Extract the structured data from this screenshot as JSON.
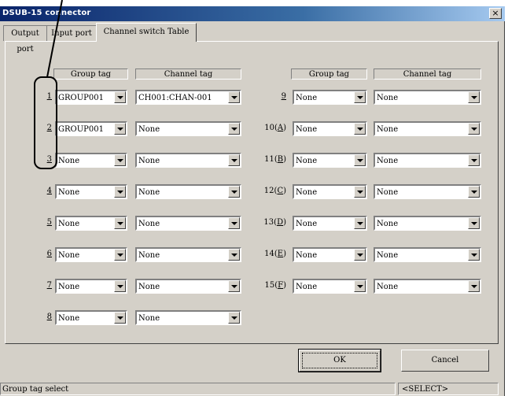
{
  "window": {
    "title": "DSUB-15 connector",
    "close_label": "×"
  },
  "tabs": [
    {
      "label": "Output port",
      "active": false
    },
    {
      "label": "Input port",
      "active": false
    },
    {
      "label": "Channel switch Table",
      "active": true
    }
  ],
  "headers": {
    "left_group": "Group tag",
    "left_channel": "Channel tag",
    "right_group": "Group tag",
    "right_channel": "Channel tag"
  },
  "left_rows": [
    {
      "label": "1",
      "group": "GROUP001",
      "channel": "CH001:CHAN-001"
    },
    {
      "label": "2",
      "group": "GROUP001",
      "channel": "None"
    },
    {
      "label": "3",
      "group": "None",
      "channel": "None"
    },
    {
      "label": "4",
      "group": "None",
      "channel": "None"
    },
    {
      "label": "5",
      "group": "None",
      "channel": "None"
    },
    {
      "label": "6",
      "group": "None",
      "channel": "None"
    },
    {
      "label": "7",
      "group": "None",
      "channel": "None"
    },
    {
      "label": "8",
      "group": "None",
      "channel": "None"
    }
  ],
  "right_rows": [
    {
      "prefix": "",
      "label": "9",
      "group": "None",
      "channel": "None"
    },
    {
      "prefix": "10(",
      "label": "A",
      "suffix": ")",
      "group": "None",
      "channel": "None"
    },
    {
      "prefix": "11(",
      "label": "B",
      "suffix": ")",
      "group": "None",
      "channel": "None"
    },
    {
      "prefix": "12(",
      "label": "C",
      "suffix": ")",
      "group": "None",
      "channel": "None"
    },
    {
      "prefix": "13(",
      "label": "D",
      "suffix": ")",
      "group": "None",
      "channel": "None"
    },
    {
      "prefix": "14(",
      "label": "E",
      "suffix": ")",
      "group": "None",
      "channel": "None"
    },
    {
      "prefix": "15(",
      "label": "F",
      "suffix": ")",
      "group": "None",
      "channel": "None"
    }
  ],
  "buttons": {
    "ok": "OK",
    "cancel": "Cancel"
  },
  "status": {
    "left": "Group tag select",
    "right": "<SELECT>"
  }
}
